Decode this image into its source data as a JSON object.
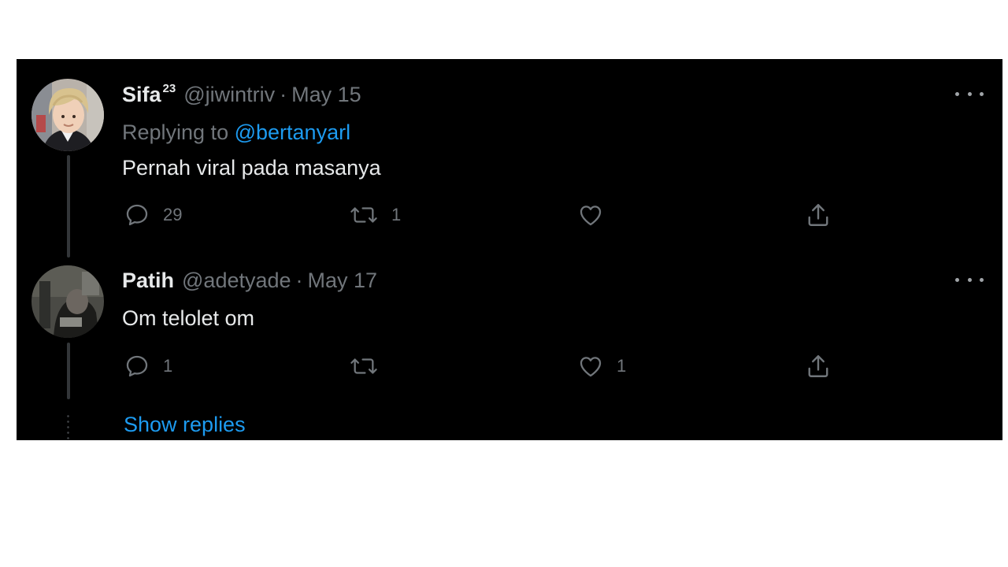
{
  "tweets": [
    {
      "display_name": "Sifa",
      "name_sup": "23",
      "handle": "@jiwintriv",
      "separator": "·",
      "date": "May 15",
      "reply_prefix": "Replying to",
      "reply_mention": "@bertanyarl",
      "text": "Pernah viral pada masanya",
      "actions": {
        "replies": "29",
        "retweets": "1",
        "likes": "",
        "share": ""
      }
    },
    {
      "display_name": "Patih",
      "handle": "@adetyade",
      "separator": "·",
      "date": "May 17",
      "text": "Om telolet om",
      "actions": {
        "replies": "1",
        "retweets": "",
        "likes": "1",
        "share": ""
      }
    }
  ],
  "show_replies_label": "Show replies",
  "icons": {
    "reply": "reply-icon",
    "retweet": "retweet-icon",
    "like": "heart-icon",
    "share": "share-icon",
    "more": "more-horizontal-icon"
  },
  "colors": {
    "background": "#000000",
    "primary_text": "#e7e9ea",
    "secondary_text": "#71767b",
    "link": "#1d9bf0",
    "thread_line": "#333639"
  }
}
